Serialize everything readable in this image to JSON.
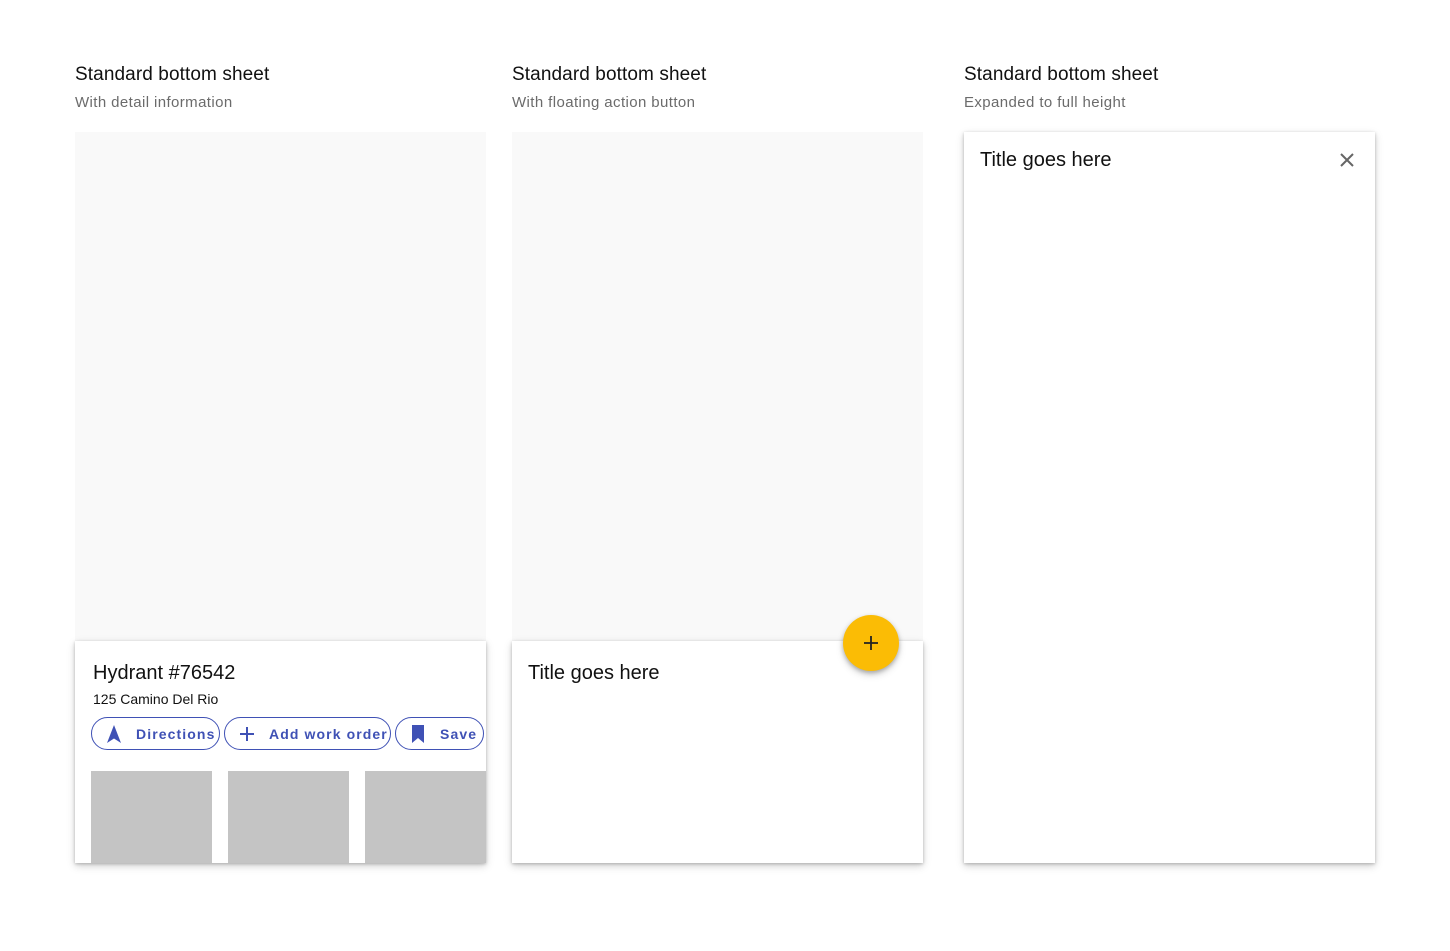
{
  "columns": [
    {
      "title": "Standard bottom sheet",
      "subtitle": "With detail information",
      "sheet": {
        "title": "Hydrant #76542",
        "subtitle": "125 Camino Del Rio",
        "chips": [
          {
            "label": "Directions",
            "icon": "navigation-arrow-icon"
          },
          {
            "label": "Add work order",
            "icon": "plus-icon"
          },
          {
            "label": "Save",
            "icon": "bookmark-icon"
          }
        ],
        "image_placeholders": 3
      }
    },
    {
      "title": "Standard bottom sheet",
      "subtitle": "With floating action button",
      "sheet": {
        "title": "Title goes here"
      },
      "fab": {
        "icon": "plus-icon"
      }
    },
    {
      "title": "Standard bottom sheet",
      "subtitle": "Expanded to full height",
      "sheet": {
        "title": "Title goes here",
        "close_icon": "close-icon"
      }
    }
  ],
  "colors": {
    "chip_accent": "#3f51b5",
    "fab": "#fbbc05",
    "placeholder": "#c4c4c4",
    "scrim_background": "#f9f9f9"
  }
}
